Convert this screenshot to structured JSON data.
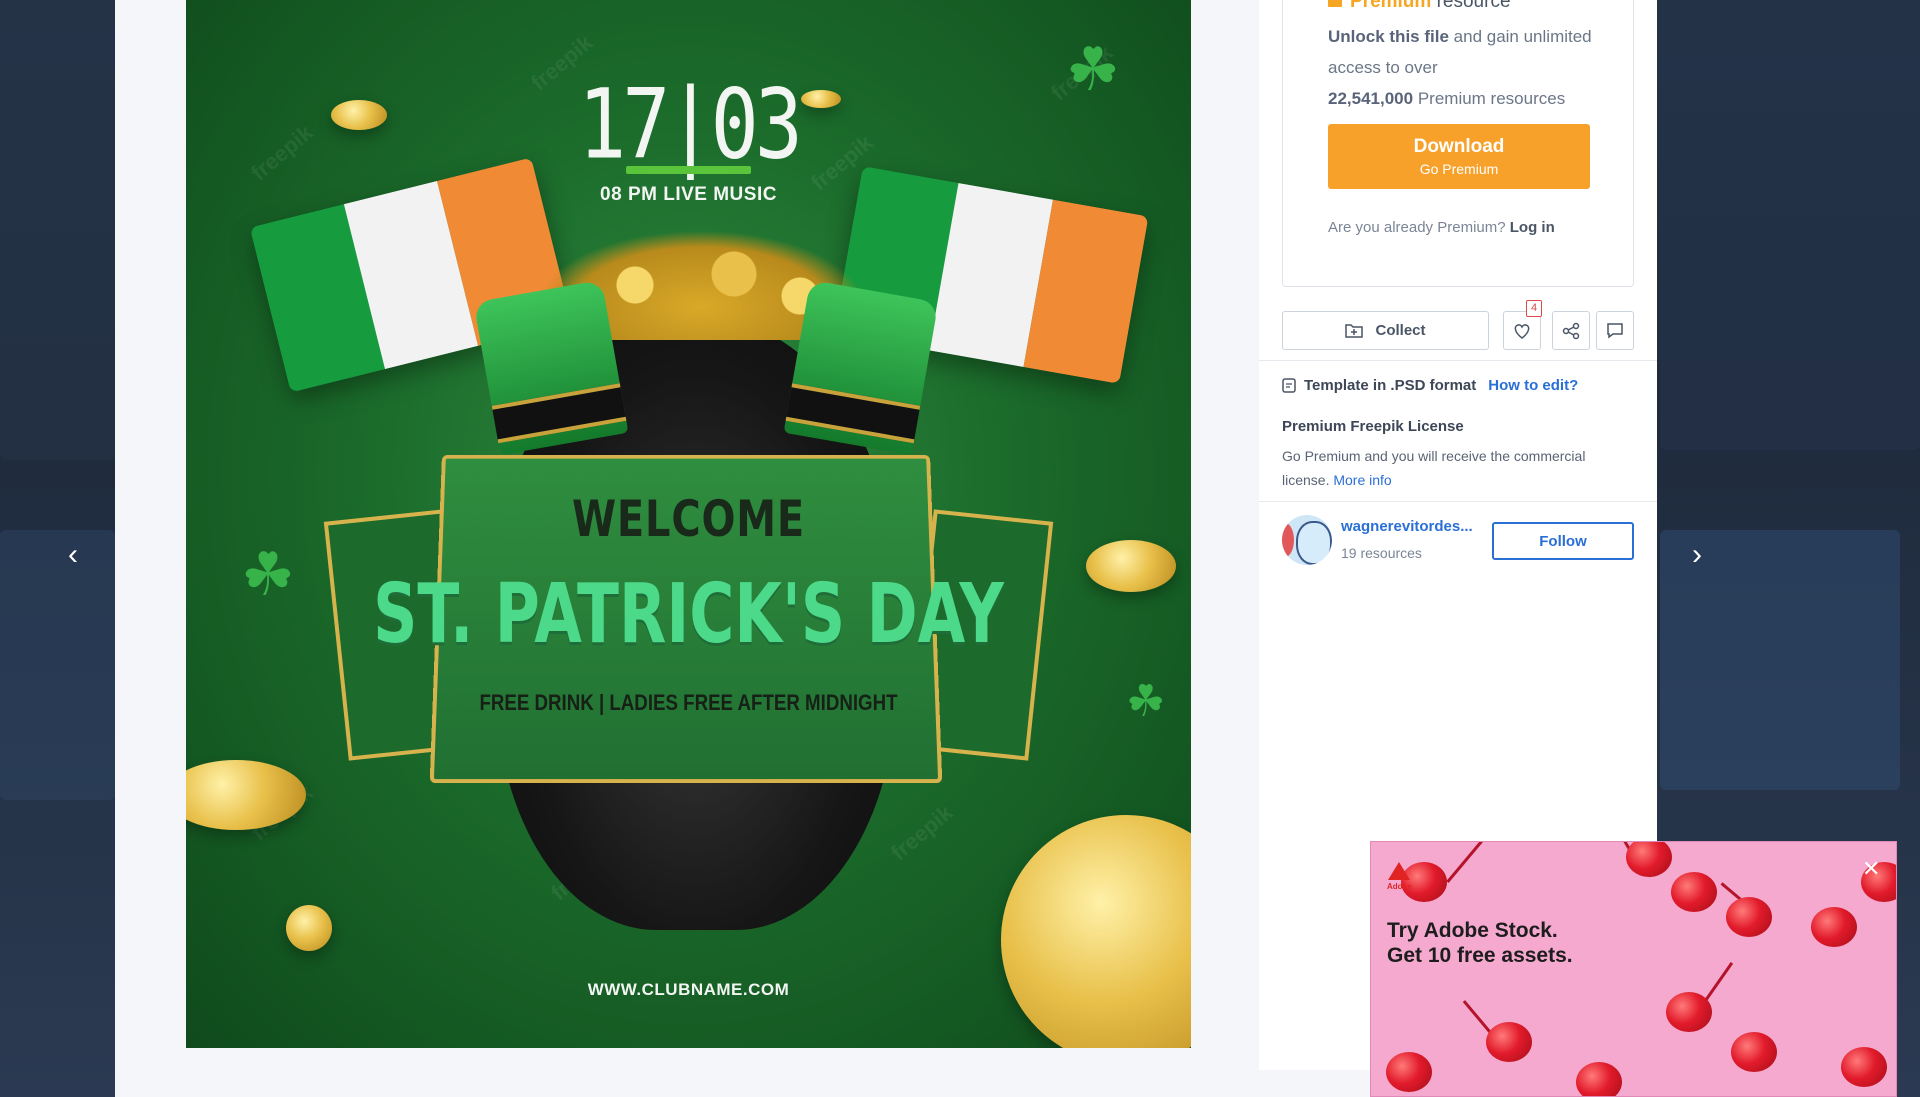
{
  "nav": {
    "prev_icon": "chevron-left-icon",
    "next_icon": "chevron-right-icon",
    "prev_glyph": "‹",
    "next_glyph": "›"
  },
  "preview": {
    "watermark": "freepik",
    "date": "17|03",
    "subtitle": "08 PM LIVE MUSIC",
    "welcome": "WELCOME",
    "title": "ST. PATRICK'S DAY",
    "tagline": "FREE DRINK | LADIES FREE AFTER MIDNIGHT",
    "url": "WWW.CLUBNAME.COM"
  },
  "premium": {
    "label_strong": "Premium",
    "label_rest": "resource",
    "unlock_strong": "Unlock this file",
    "unlock_rest": "and gain unlimited access to over",
    "count": "22,541,000",
    "count_suffix": "Premium resources",
    "download_label": "Download",
    "download_sub": "Go Premium",
    "already_text": "Are you already Premium?",
    "login_link": "Log in"
  },
  "actions": {
    "collect_label": "Collect",
    "likes_count": "4"
  },
  "format": {
    "label": "Template in .PSD format",
    "how_link": "How to edit?"
  },
  "license": {
    "title": "Premium Freepik License",
    "text": "Go Premium and you will receive the commercial license.",
    "more_link": "More info"
  },
  "author": {
    "name": "wagnerevitordes...",
    "resources": "19 resources",
    "follow_label": "Follow"
  },
  "ad": {
    "brand": "Adobe",
    "headline": "Try Adobe Stock.\nGet 10 free assets.",
    "close_glyph": "✕"
  },
  "colors": {
    "accent_orange": "#f7a12b",
    "link_blue": "#2a6fd6",
    "poster_green": "#1b6b2b",
    "ad_pink": "#f5a9cf"
  }
}
